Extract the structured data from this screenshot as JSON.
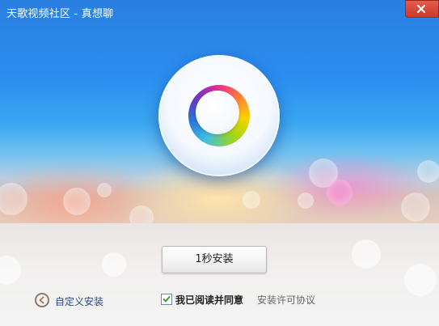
{
  "window": {
    "title": "天歌视频社区 - 真想聊",
    "close_icon": "close-icon"
  },
  "hero": {
    "logo_icon": "tiange-logo-icon"
  },
  "actions": {
    "install_label": "1秒安装",
    "custom_install_label": "自定义安装",
    "custom_install_icon": "back-arrow-icon"
  },
  "agreement": {
    "checked": true,
    "agree_text": "我已阅读并同意",
    "license_link": "安装许可协议"
  },
  "colors": {
    "sky_blue": "#2b8ef0",
    "link_blue": "#2a4a8a",
    "close_red": "#d84a3a"
  }
}
